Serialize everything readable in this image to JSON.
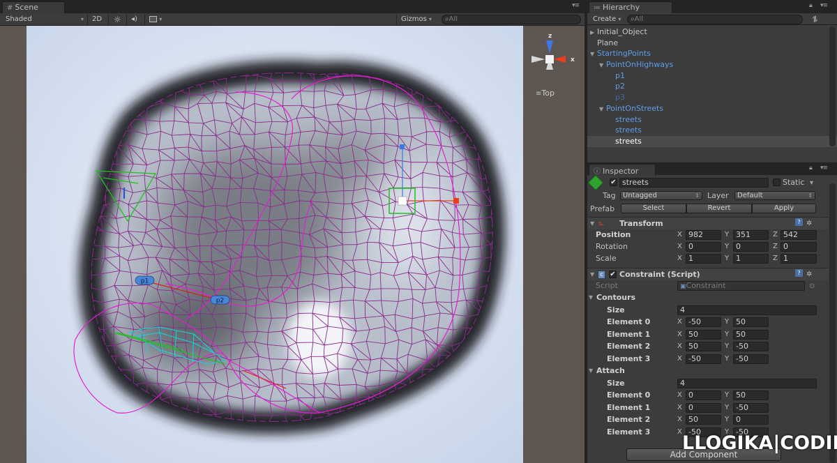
{
  "scene": {
    "tab_label": "Scene",
    "shading_mode": "Shaded",
    "mode_2d": "2D",
    "gizmos_label": "Gizmos",
    "search_placeholder": "All",
    "gizmo_axis_z": "z",
    "gizmo_axis_x": "x",
    "view_label": "Top",
    "labels": [
      {
        "text": "p1"
      },
      {
        "text": "p2"
      }
    ]
  },
  "hierarchy": {
    "tab_label": "Hierarchy",
    "create_label": "Create",
    "search_placeholder": "All",
    "items": [
      {
        "label": "Initial_Object",
        "depth": 0,
        "prefab": false,
        "arrow": "▶"
      },
      {
        "label": "Plane",
        "depth": 0,
        "prefab": false,
        "arrow": ""
      },
      {
        "label": "StartingPoints",
        "depth": 0,
        "prefab": true,
        "arrow": "▼"
      },
      {
        "label": "PointOnHighways",
        "depth": 1,
        "prefab": true,
        "arrow": "▼"
      },
      {
        "label": "p1",
        "depth": 2,
        "prefab": true,
        "arrow": ""
      },
      {
        "label": "p2",
        "depth": 2,
        "prefab": true,
        "arrow": ""
      },
      {
        "label": "p3",
        "depth": 2,
        "prefab": true,
        "dim": true,
        "arrow": ""
      },
      {
        "label": "PointOnStreets",
        "depth": 1,
        "prefab": true,
        "arrow": "▼"
      },
      {
        "label": "streets",
        "depth": 2,
        "prefab": true,
        "arrow": ""
      },
      {
        "label": "streets",
        "depth": 2,
        "prefab": true,
        "arrow": ""
      },
      {
        "label": "streets",
        "depth": 2,
        "prefab": false,
        "selected": true,
        "arrow": ""
      }
    ]
  },
  "inspector": {
    "tab_label": "Inspector",
    "object_name": "streets",
    "static_label": "Static",
    "tag_label": "Tag",
    "tag_value": "Untagged",
    "layer_label": "Layer",
    "layer_value": "Default",
    "prefab_label": "Prefab",
    "select_label": "Select",
    "revert_label": "Revert",
    "apply_label": "Apply",
    "transform": {
      "title": "Transform",
      "position_label": "Position",
      "rotation_label": "Rotation",
      "scale_label": "Scale",
      "position": {
        "x": "982",
        "y": "351",
        "z": "542"
      },
      "rotation": {
        "x": "0",
        "y": "0",
        "z": "0"
      },
      "scale": {
        "x": "1",
        "y": "1",
        "z": "1"
      }
    },
    "constraint": {
      "title": "Constraint (Script)",
      "script_label": "Script",
      "script_value": "Constraint",
      "contours_label": "Contours",
      "attach_label": "Attach",
      "size_label": "Size",
      "contours_size": "4",
      "attach_size": "4",
      "contours": [
        {
          "label": "Element 0",
          "x": "-50",
          "y": "50"
        },
        {
          "label": "Element 1",
          "x": "50",
          "y": "50"
        },
        {
          "label": "Element 2",
          "x": "50",
          "y": "-50"
        },
        {
          "label": "Element 3",
          "x": "-50",
          "y": "-50"
        }
      ],
      "attach": [
        {
          "label": "Element 0",
          "x": "0",
          "y": "50"
        },
        {
          "label": "Element 1",
          "x": "0",
          "y": "-50"
        },
        {
          "label": "Element 2",
          "x": "50",
          "y": "0"
        },
        {
          "label": "Element 3",
          "x": "-50",
          "y": "-50"
        }
      ]
    },
    "add_component_label": "Add Component"
  },
  "axis_letters": {
    "x": "X",
    "y": "Y",
    "z": "Z"
  },
  "watermark": "LLOGIKA|CODIN",
  "colors": {
    "mesh": "#8a2c8c",
    "curve": "#e61ed2",
    "selection": "#20c020",
    "prefab_text": "#5f9de8",
    "axis_x": "#e8401c",
    "axis_y": "#78c83c",
    "axis_z": "#3c78e8"
  }
}
